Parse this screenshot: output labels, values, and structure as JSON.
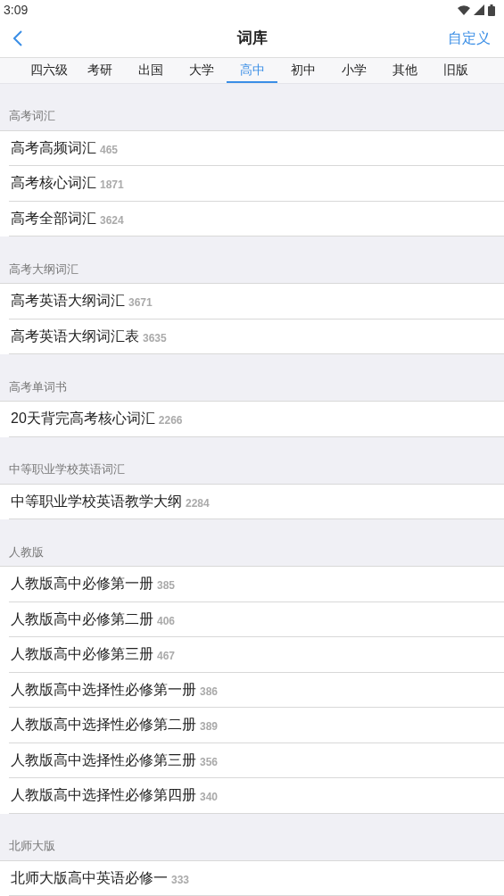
{
  "status_bar": {
    "time": "3:09"
  },
  "header": {
    "title": "词库",
    "action": "自定义"
  },
  "tabs": [
    {
      "label": "四六级",
      "selected": false
    },
    {
      "label": "考研",
      "selected": false
    },
    {
      "label": "出国",
      "selected": false
    },
    {
      "label": "大学",
      "selected": false
    },
    {
      "label": "高中",
      "selected": true
    },
    {
      "label": "初中",
      "selected": false
    },
    {
      "label": "小学",
      "selected": false
    },
    {
      "label": "其他",
      "selected": false
    },
    {
      "label": "旧版",
      "selected": false
    }
  ],
  "sections": [
    {
      "title": "高考词汇",
      "items": [
        {
          "name": "高考高频词汇",
          "count": "465"
        },
        {
          "name": "高考核心词汇",
          "count": "1871"
        },
        {
          "name": "高考全部词汇",
          "count": "3624"
        }
      ]
    },
    {
      "title": "高考大纲词汇",
      "items": [
        {
          "name": "高考英语大纲词汇",
          "count": "3671"
        },
        {
          "name": "高考英语大纲词汇表",
          "count": "3635"
        }
      ]
    },
    {
      "title": "高考单词书",
      "items": [
        {
          "name": "20天背完高考核心词汇",
          "count": "2266"
        }
      ]
    },
    {
      "title": "中等职业学校英语词汇",
      "items": [
        {
          "name": "中等职业学校英语教学大纲",
          "count": "2284"
        }
      ]
    },
    {
      "title": "人教版",
      "items": [
        {
          "name": "人教版高中必修第一册",
          "count": "385"
        },
        {
          "name": "人教版高中必修第二册",
          "count": "406"
        },
        {
          "name": "人教版高中必修第三册",
          "count": "467"
        },
        {
          "name": "人教版高中选择性必修第一册",
          "count": "386"
        },
        {
          "name": "人教版高中选择性必修第二册",
          "count": "389"
        },
        {
          "name": "人教版高中选择性必修第三册",
          "count": "356"
        },
        {
          "name": "人教版高中选择性必修第四册",
          "count": "340"
        }
      ]
    },
    {
      "title": "北师大版",
      "items": [
        {
          "name": "北师大版高中英语必修一",
          "count": "333"
        }
      ]
    }
  ]
}
